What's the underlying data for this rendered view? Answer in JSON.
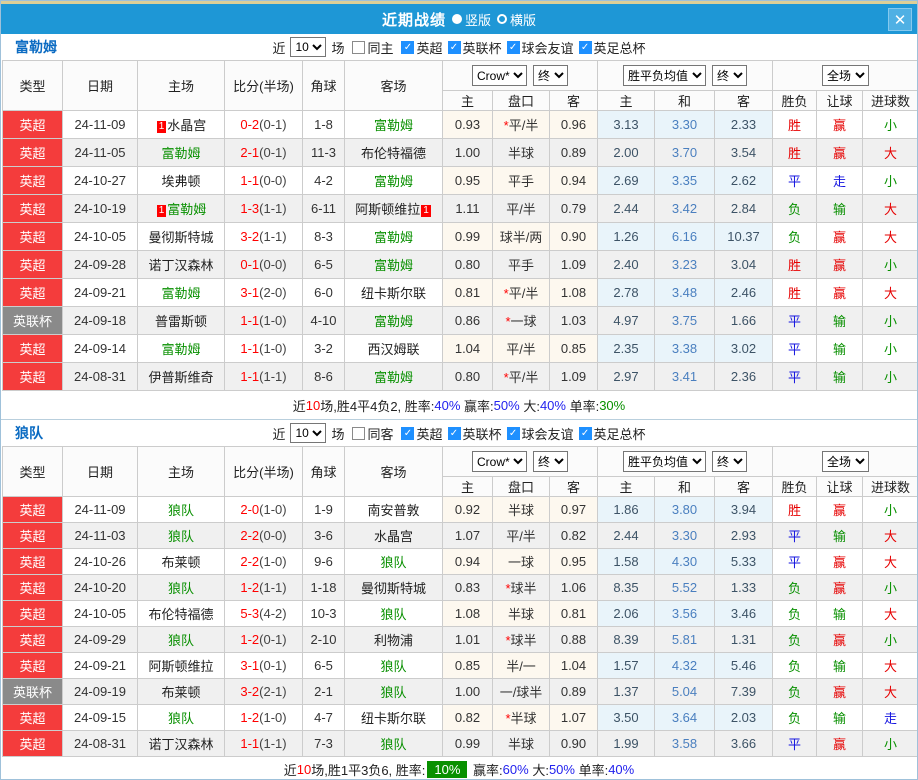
{
  "titlebar": {
    "title": "近期战绩",
    "radios": [
      {
        "label": "竖版",
        "selected": true
      },
      {
        "label": "横版",
        "selected": false
      }
    ],
    "close_label": "✕"
  },
  "columns": {
    "type": "类型",
    "date": "日期",
    "home": "主场",
    "score": "比分(半场)",
    "corner": "角球",
    "away": "客场",
    "odds_home": "主",
    "handicap": "盘口",
    "odds_away": "客",
    "avg_home": "主",
    "avg_draw": "和",
    "avg_away": "客",
    "result": "胜负",
    "asia": "让球",
    "goals": "进球数"
  },
  "controls": {
    "company": "Crow*",
    "final1": "终",
    "avg": "胜平负均值",
    "final2": "终",
    "scope": "全场"
  },
  "sections": [
    {
      "team": "富勒姆",
      "filter": {
        "near": "近",
        "count": "10",
        "games": "场",
        "same": {
          "label": "同主",
          "checked": false
        },
        "leagues": [
          {
            "label": "英超",
            "checked": true
          },
          {
            "label": "英联杯",
            "checked": true
          },
          {
            "label": "球会友谊",
            "checked": true
          },
          {
            "label": "英足总杯",
            "checked": true
          }
        ]
      },
      "rows": [
        {
          "league": "英超",
          "league_class": "epl",
          "date": "24-11-09",
          "home_pre": "1",
          "home": "水晶宫",
          "score": "0-2",
          "half": "(0-1)",
          "corner": "1-8",
          "away": "富勒姆",
          "away_class": "green",
          "odds_home": "0.93",
          "star": "*",
          "handicap": "平/半",
          "odds_away": "0.96",
          "avg_home": "3.13",
          "avg_draw": "3.30",
          "avg_away": "2.33",
          "result": "胜",
          "result_class": "red",
          "asia": "赢",
          "asia_class": "red",
          "goals": "小",
          "goals_class": "green"
        },
        {
          "league": "英超",
          "league_class": "epl",
          "date": "24-11-05",
          "home": "富勒姆",
          "home_class": "green",
          "score": "2-1",
          "half": "(0-1)",
          "corner": "11-3",
          "away": "布伦特福德",
          "odds_home": "1.00",
          "handicap": "半球",
          "odds_away": "0.89",
          "avg_home": "2.00",
          "avg_draw": "3.70",
          "avg_away": "3.54",
          "result": "胜",
          "result_class": "red",
          "asia": "赢",
          "asia_class": "red",
          "goals": "大",
          "goals_class": "red"
        },
        {
          "league": "英超",
          "league_class": "epl",
          "date": "24-10-27",
          "home": "埃弗顿",
          "score": "1-1",
          "half": "(0-0)",
          "corner": "4-2",
          "away": "富勒姆",
          "away_class": "green",
          "odds_home": "0.95",
          "handicap": "平手",
          "odds_away": "0.94",
          "avg_home": "2.69",
          "avg_draw": "3.35",
          "avg_away": "2.62",
          "result": "平",
          "result_class": "blue",
          "asia": "走",
          "asia_class": "blue",
          "goals": "小",
          "goals_class": "green"
        },
        {
          "league": "英超",
          "league_class": "epl",
          "date": "24-10-19",
          "home_pre": "1",
          "home": "富勒姆",
          "home_class": "green",
          "score": "1-3",
          "half": "(1-1)",
          "corner": "6-11",
          "away": "阿斯顿维拉",
          "away_post": "1",
          "odds_home": "1.11",
          "handicap": "平/半",
          "odds_away": "0.79",
          "avg_home": "2.44",
          "avg_draw": "3.42",
          "avg_away": "2.84",
          "result": "负",
          "result_class": "green",
          "asia": "输",
          "asia_class": "green",
          "goals": "大",
          "goals_class": "red"
        },
        {
          "league": "英超",
          "league_class": "epl",
          "date": "24-10-05",
          "home": "曼彻斯特城",
          "score": "3-2",
          "half": "(1-1)",
          "corner": "8-3",
          "away": "富勒姆",
          "away_class": "green",
          "odds_home": "0.99",
          "handicap": "球半/两",
          "odds_away": "0.90",
          "avg_home": "1.26",
          "avg_draw": "6.16",
          "avg_away": "10.37",
          "result": "负",
          "result_class": "green",
          "asia": "赢",
          "asia_class": "red",
          "goals": "大",
          "goals_class": "red"
        },
        {
          "league": "英超",
          "league_class": "epl",
          "date": "24-09-28",
          "home": "诺丁汉森林",
          "score": "0-1",
          "half": "(0-0)",
          "corner": "6-5",
          "away": "富勒姆",
          "away_class": "green",
          "odds_home": "0.80",
          "handicap": "平手",
          "odds_away": "1.09",
          "avg_home": "2.40",
          "avg_draw": "3.23",
          "avg_away": "3.04",
          "result": "胜",
          "result_class": "red",
          "asia": "赢",
          "asia_class": "red",
          "goals": "小",
          "goals_class": "green"
        },
        {
          "league": "英超",
          "league_class": "epl",
          "date": "24-09-21",
          "home": "富勒姆",
          "home_class": "green",
          "score": "3-1",
          "half": "(2-0)",
          "corner": "6-0",
          "away": "纽卡斯尔联",
          "odds_home": "0.81",
          "star": "*",
          "handicap": "平/半",
          "odds_away": "1.08",
          "avg_home": "2.78",
          "avg_draw": "3.48",
          "avg_away": "2.46",
          "result": "胜",
          "result_class": "red",
          "asia": "赢",
          "asia_class": "red",
          "goals": "大",
          "goals_class": "red"
        },
        {
          "league": "英联杯",
          "league_class": "cup",
          "date": "24-09-18",
          "home": "普雷斯顿",
          "score": "1-1",
          "half": "(1-0)",
          "corner": "4-10",
          "away": "富勒姆",
          "away_class": "green",
          "odds_home": "0.86",
          "star": "*",
          "handicap": "一球",
          "odds_away": "1.03",
          "avg_home": "4.97",
          "avg_draw": "3.75",
          "avg_away": "1.66",
          "result": "平",
          "result_class": "blue",
          "asia": "输",
          "asia_class": "green",
          "goals": "小",
          "goals_class": "green"
        },
        {
          "league": "英超",
          "league_class": "epl",
          "date": "24-09-14",
          "home": "富勒姆",
          "home_class": "green",
          "score": "1-1",
          "half": "(1-0)",
          "corner": "3-2",
          "away": "西汉姆联",
          "odds_home": "1.04",
          "handicap": "平/半",
          "odds_away": "0.85",
          "avg_home": "2.35",
          "avg_draw": "3.38",
          "avg_away": "3.02",
          "result": "平",
          "result_class": "blue",
          "asia": "输",
          "asia_class": "green",
          "goals": "小",
          "goals_class": "green"
        },
        {
          "league": "英超",
          "league_class": "epl",
          "date": "24-08-31",
          "home": "伊普斯维奇",
          "score": "1-1",
          "half": "(1-1)",
          "corner": "8-6",
          "away": "富勒姆",
          "away_class": "green",
          "odds_home": "0.80",
          "star": "*",
          "handicap": "平/半",
          "odds_away": "1.09",
          "avg_home": "2.97",
          "avg_draw": "3.41",
          "avg_away": "2.36",
          "result": "平",
          "result_class": "blue",
          "asia": "输",
          "asia_class": "green",
          "goals": "小",
          "goals_class": "green"
        }
      ],
      "summary": [
        {
          "t": "近"
        },
        {
          "t": "10",
          "c": "red"
        },
        {
          "t": "场,胜4平4负2, "
        },
        {
          "t": "胜率:"
        },
        {
          "t": "40%",
          "c": "blue"
        },
        {
          "t": " 赢率:"
        },
        {
          "t": "50%",
          "c": "blue"
        },
        {
          "t": " 大:"
        },
        {
          "t": "40%",
          "c": "blue"
        },
        {
          "t": " 单率:"
        },
        {
          "t": "30%",
          "c": "green"
        }
      ]
    },
    {
      "team": "狼队",
      "filter": {
        "near": "近",
        "count": "10",
        "games": "场",
        "same": {
          "label": "同客",
          "checked": false
        },
        "leagues": [
          {
            "label": "英超",
            "checked": true
          },
          {
            "label": "英联杯",
            "checked": true
          },
          {
            "label": "球会友谊",
            "checked": true
          },
          {
            "label": "英足总杯",
            "checked": true
          }
        ]
      },
      "rows": [
        {
          "league": "英超",
          "league_class": "epl",
          "date": "24-11-09",
          "home": "狼队",
          "home_class": "green",
          "score": "2-0",
          "half": "(1-0)",
          "corner": "1-9",
          "away": "南安普敦",
          "odds_home": "0.92",
          "handicap": "半球",
          "odds_away": "0.97",
          "avg_home": "1.86",
          "avg_draw": "3.80",
          "avg_away": "3.94",
          "result": "胜",
          "result_class": "red",
          "asia": "赢",
          "asia_class": "red",
          "goals": "小",
          "goals_class": "green"
        },
        {
          "league": "英超",
          "league_class": "epl",
          "date": "24-11-03",
          "home": "狼队",
          "home_class": "green",
          "score": "2-2",
          "half": "(0-0)",
          "corner": "3-6",
          "away": "水晶宫",
          "odds_home": "1.07",
          "handicap": "平/半",
          "odds_away": "0.82",
          "avg_home": "2.44",
          "avg_draw": "3.30",
          "avg_away": "2.93",
          "result": "平",
          "result_class": "blue",
          "asia": "输",
          "asia_class": "green",
          "goals": "大",
          "goals_class": "red"
        },
        {
          "league": "英超",
          "league_class": "epl",
          "date": "24-10-26",
          "home": "布莱顿",
          "score": "2-2",
          "half": "(1-0)",
          "corner": "9-6",
          "away": "狼队",
          "away_class": "green",
          "odds_home": "0.94",
          "handicap": "一球",
          "odds_away": "0.95",
          "avg_home": "1.58",
          "avg_draw": "4.30",
          "avg_away": "5.33",
          "result": "平",
          "result_class": "blue",
          "asia": "赢",
          "asia_class": "red",
          "goals": "大",
          "goals_class": "red"
        },
        {
          "league": "英超",
          "league_class": "epl",
          "date": "24-10-20",
          "home": "狼队",
          "home_class": "green",
          "score": "1-2",
          "half": "(1-1)",
          "corner": "1-18",
          "away": "曼彻斯特城",
          "odds_home": "0.83",
          "star": "*",
          "handicap": "球半",
          "odds_away": "1.06",
          "avg_home": "8.35",
          "avg_draw": "5.52",
          "avg_away": "1.33",
          "result": "负",
          "result_class": "green",
          "asia": "赢",
          "asia_class": "red",
          "goals": "小",
          "goals_class": "green"
        },
        {
          "league": "英超",
          "league_class": "epl",
          "date": "24-10-05",
          "home": "布伦特福德",
          "score": "5-3",
          "half": "(4-2)",
          "corner": "10-3",
          "away": "狼队",
          "away_class": "green",
          "odds_home": "1.08",
          "handicap": "半球",
          "odds_away": "0.81",
          "avg_home": "2.06",
          "avg_draw": "3.56",
          "avg_away": "3.46",
          "result": "负",
          "result_class": "green",
          "asia": "输",
          "asia_class": "green",
          "goals": "大",
          "goals_class": "red"
        },
        {
          "league": "英超",
          "league_class": "epl",
          "date": "24-09-29",
          "home": "狼队",
          "home_class": "green",
          "score": "1-2",
          "half": "(0-1)",
          "corner": "2-10",
          "away": "利物浦",
          "odds_home": "1.01",
          "star": "*",
          "handicap": "球半",
          "odds_away": "0.88",
          "avg_home": "8.39",
          "avg_draw": "5.81",
          "avg_away": "1.31",
          "result": "负",
          "result_class": "green",
          "asia": "赢",
          "asia_class": "red",
          "goals": "小",
          "goals_class": "green"
        },
        {
          "league": "英超",
          "league_class": "epl",
          "date": "24-09-21",
          "home": "阿斯顿维拉",
          "score": "3-1",
          "half": "(0-1)",
          "corner": "6-5",
          "away": "狼队",
          "away_class": "green",
          "odds_home": "0.85",
          "handicap": "半/一",
          "odds_away": "1.04",
          "avg_home": "1.57",
          "avg_draw": "4.32",
          "avg_away": "5.46",
          "result": "负",
          "result_class": "green",
          "asia": "输",
          "asia_class": "green",
          "goals": "大",
          "goals_class": "red"
        },
        {
          "league": "英联杯",
          "league_class": "cup",
          "date": "24-09-19",
          "home": "布莱顿",
          "score": "3-2",
          "half": "(2-1)",
          "corner": "2-1",
          "away": "狼队",
          "away_class": "green",
          "odds_home": "1.00",
          "handicap": "一/球半",
          "odds_away": "0.89",
          "avg_home": "1.37",
          "avg_draw": "5.04",
          "avg_away": "7.39",
          "result": "负",
          "result_class": "green",
          "asia": "赢",
          "asia_class": "red",
          "goals": "大",
          "goals_class": "red"
        },
        {
          "league": "英超",
          "league_class": "epl",
          "date": "24-09-15",
          "home": "狼队",
          "home_class": "green",
          "score": "1-2",
          "half": "(1-0)",
          "corner": "4-7",
          "away": "纽卡斯尔联",
          "odds_home": "0.82",
          "star": "*",
          "handicap": "半球",
          "odds_away": "1.07",
          "avg_home": "3.50",
          "avg_draw": "3.64",
          "avg_away": "2.03",
          "result": "负",
          "result_class": "green",
          "asia": "输",
          "asia_class": "green",
          "goals": "走",
          "goals_class": "blue"
        },
        {
          "league": "英超",
          "league_class": "epl",
          "date": "24-08-31",
          "home": "诺丁汉森林",
          "score": "1-1",
          "half": "(1-1)",
          "corner": "7-3",
          "away": "狼队",
          "away_class": "green",
          "odds_home": "0.99",
          "handicap": "半球",
          "odds_away": "0.90",
          "avg_home": "1.99",
          "avg_draw": "3.58",
          "avg_away": "3.66",
          "result": "平",
          "result_class": "blue",
          "asia": "赢",
          "asia_class": "red",
          "goals": "小",
          "goals_class": "green"
        }
      ],
      "summary": [
        {
          "t": "近"
        },
        {
          "t": "10",
          "c": "red"
        },
        {
          "t": "场,胜1平3负6, "
        },
        {
          "t": "胜率:"
        },
        {
          "t": "10%",
          "c": "badge"
        },
        {
          "t": " 赢率:"
        },
        {
          "t": "60%",
          "c": "blue"
        },
        {
          "t": " 大:"
        },
        {
          "t": "50%",
          "c": "blue"
        },
        {
          "t": " 单率:"
        },
        {
          "t": "40%",
          "c": "blue"
        }
      ]
    }
  ]
}
